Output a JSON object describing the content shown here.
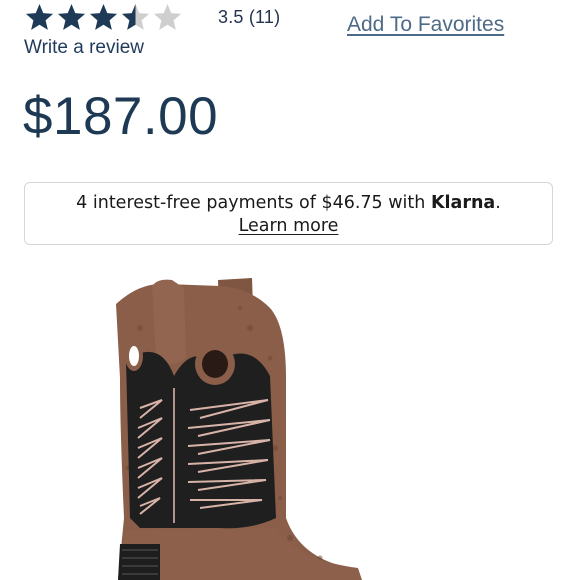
{
  "rating": {
    "value": 3.5,
    "max": 5,
    "text": "3.5 (11)",
    "filled_color": "#1e3a56",
    "empty_color": "#cfcfcf"
  },
  "links": {
    "add_to_favorites": "Add To Favorites",
    "write_review": "Write a review"
  },
  "price": {
    "display": "$187.00"
  },
  "klarna": {
    "text_before": "4 interest-free payments of $46.75 with ",
    "brand": "Klarna",
    "text_after": ".",
    "learn_more": "Learn more"
  },
  "product_image": {
    "icon": "cowboy-boot-image",
    "colors": {
      "leather": "#8a5e48",
      "dark_panel": "#1e1e1f",
      "stitching": "#d8b3a8"
    }
  }
}
